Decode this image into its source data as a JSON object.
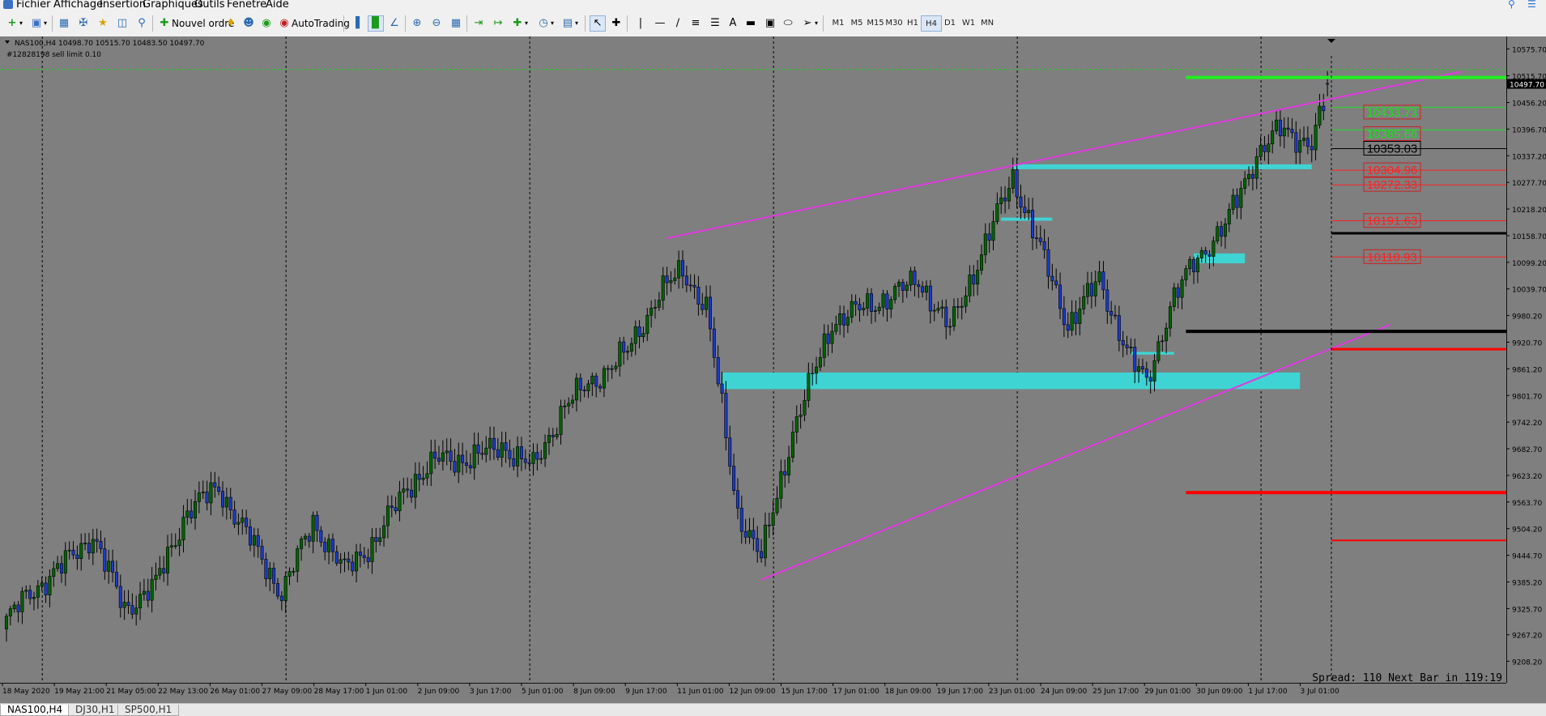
{
  "menu": {
    "items": [
      "Fichier",
      "Affichage",
      "Insertion",
      "Graphiques",
      "Outils",
      "Fenetre",
      "Aide"
    ]
  },
  "toolbar": {
    "new_order_label": "Nouvel ordre",
    "autotrading_label": "AutoTrading",
    "timeframes": [
      "M1",
      "M5",
      "M15",
      "M30",
      "H1",
      "H4",
      "D1",
      "W1",
      "MN"
    ],
    "active_timeframe": "H4"
  },
  "tabs": {
    "items": [
      "NAS100,H4",
      "DJ30,H1",
      "SP500,H1"
    ],
    "active": "NAS100,H4"
  },
  "chart_data": {
    "type": "candlestick",
    "symbol_header": "NAS100,H4  10498.70 10515.70 10483.50 10497.70",
    "order_label": "#12828198 sell limit 0.10",
    "status_text": "Spread: 110 Next Bar in 119:19",
    "current_price": "10497.70",
    "colors": {
      "background": "#7f7f7f",
      "bull": "#006400",
      "bear": "#1a3acc",
      "trendline": "#e038e0",
      "zone": "#3fd4d4"
    },
    "ylim": [
      9160,
      10600
    ],
    "y_ticks": [
      "10575.70",
      "10515.70",
      "10456.20",
      "10396.70",
      "10337.20",
      "10277.70",
      "10218.20",
      "10158.70",
      "10099.20",
      "10039.70",
      "9980.20",
      "9920.70",
      "9861.20",
      "9801.70",
      "9742.20",
      "9682.70",
      "9623.20",
      "9563.70",
      "9504.20",
      "9444.70",
      "9385.20",
      "9325.70",
      "9267.20",
      "9208.20"
    ],
    "x_labels": [
      "18 May 2020",
      "19 May 21:00",
      "21 May 05:00",
      "22 May 13:00",
      "26 May 01:00",
      "27 May 09:00",
      "28 May 17:00",
      "1 Jun 01:00",
      "2 Jun 09:00",
      "3 Jun 17:00",
      "5 Jun 01:00",
      "8 Jun 09:00",
      "9 Jun 17:00",
      "11 Jun 01:00",
      "12 Jun 09:00",
      "15 Jun 17:00",
      "17 Jun 01:00",
      "18 Jun 09:00",
      "19 Jun 17:00",
      "23 Jun 01:00",
      "24 Jun 09:00",
      "25 Jun 17:00",
      "29 Jun 01:00",
      "30 Jun 09:00",
      "1 Jul 17:00",
      "3 Jul 01:00"
    ],
    "levels": [
      {
        "label": "10433.73",
        "value": 10433.73,
        "color": "#22dd22",
        "type": "tp"
      },
      {
        "label": "10385.66",
        "value": 10385.66,
        "color": "#22dd22",
        "type": "tp"
      },
      {
        "label": "10353.03",
        "value": 10353.03,
        "color": "#000000",
        "type": "entry"
      },
      {
        "label": "10304.96",
        "value": 10304.96,
        "color": "#ff2020",
        "type": "sl"
      },
      {
        "label": "10272.33",
        "value": 10272.33,
        "color": "#ff2020",
        "type": "sl"
      },
      {
        "label": "10191.63",
        "value": 10191.63,
        "color": "#ff2020",
        "type": "sl"
      },
      {
        "label": "10110.93",
        "value": 10110.93,
        "color": "#ff2020",
        "type": "sl"
      }
    ],
    "horizontal_lines": [
      {
        "value": 10512,
        "color": "#22ee22",
        "width": 4,
        "from_time": 300
      },
      {
        "value": 10164,
        "color": "#000000",
        "width": 3,
        "from_time": 337
      },
      {
        "value": 9945,
        "color": "#000000",
        "width": 4,
        "from_time": 300
      },
      {
        "value": 9905,
        "color": "#ff0000",
        "width": 3,
        "from_time": 337
      },
      {
        "value": 9585,
        "color": "#ff0000",
        "width": 4,
        "from_time": 300
      },
      {
        "value": 9478,
        "color": "#ff0000",
        "width": 2,
        "from_time": 337
      },
      {
        "value": 10445,
        "color": "#22dd22",
        "width": 1,
        "from_time": 337
      },
      {
        "value": 10395,
        "color": "#22dd22",
        "width": 1,
        "from_time": 337
      },
      {
        "value": 10353,
        "color": "#000000",
        "width": 1,
        "from_time": 337
      },
      {
        "value": 10305,
        "color": "#ff2020",
        "width": 1,
        "from_time": 337
      },
      {
        "value": 10272,
        "color": "#ff2020",
        "width": 1,
        "from_time": 337
      },
      {
        "value": 10192,
        "color": "#ff2020",
        "width": 1,
        "from_time": 337
      },
      {
        "value": 10111,
        "color": "#ff2020",
        "width": 1,
        "from_time": 337
      }
    ],
    "trendlines": [
      {
        "t1": 168,
        "v1": 10153,
        "t2": 370,
        "v2": 10525
      },
      {
        "t1": 192,
        "v1": 9390,
        "t2": 352,
        "v2": 9960
      }
    ],
    "zones": [
      {
        "t1": 182,
        "t2": 329,
        "top": 9853,
        "bottom": 9816
      },
      {
        "t1": 256,
        "t2": 332,
        "top": 10318,
        "bottom": 10307
      },
      {
        "t1": 302,
        "t2": 315,
        "top": 10119,
        "bottom": 10097
      },
      {
        "t1": 253,
        "t2": 266,
        "top": 10199,
        "bottom": 10192
      },
      {
        "t1": 286,
        "t2": 297,
        "top": 9899,
        "bottom": 9893
      }
    ],
    "candles": {
      "start": 9280,
      "count": 337,
      "anchors": [
        [
          0,
          9300
        ],
        [
          6,
          9360
        ],
        [
          14,
          9420
        ],
        [
          22,
          9490
        ],
        [
          30,
          9325
        ],
        [
          38,
          9380
        ],
        [
          46,
          9545
        ],
        [
          54,
          9595
        ],
        [
          62,
          9480
        ],
        [
          70,
          9360
        ],
        [
          78,
          9520
        ],
        [
          86,
          9410
        ],
        [
          94,
          9480
        ],
        [
          102,
          9600
        ],
        [
          110,
          9660
        ],
        [
          118,
          9660
        ],
        [
          126,
          9690
        ],
        [
          134,
          9640
        ],
        [
          142,
          9780
        ],
        [
          150,
          9840
        ],
        [
          158,
          9900
        ],
        [
          166,
          10030
        ],
        [
          172,
          10080
        ],
        [
          178,
          10000
        ],
        [
          186,
          9540
        ],
        [
          192,
          9440
        ],
        [
          200,
          9720
        ],
        [
          210,
          9965
        ],
        [
          216,
          9990
        ],
        [
          224,
          10020
        ],
        [
          232,
          10060
        ],
        [
          240,
          9950
        ],
        [
          248,
          10120
        ],
        [
          256,
          10290
        ],
        [
          262,
          10150
        ],
        [
          270,
          9960
        ],
        [
          278,
          10060
        ],
        [
          286,
          9880
        ],
        [
          290,
          9830
        ],
        [
          296,
          10000
        ],
        [
          302,
          10100
        ],
        [
          310,
          10180
        ],
        [
          318,
          10340
        ],
        [
          324,
          10395
        ],
        [
          332,
          10365
        ],
        [
          337,
          10500
        ]
      ],
      "last_ohlc": [
        10498.7,
        10515.7,
        10483.5,
        10497.7
      ]
    }
  }
}
